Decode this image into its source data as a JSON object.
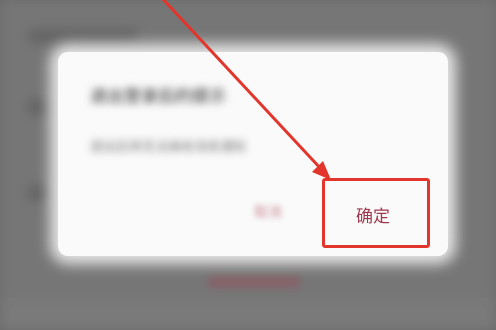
{
  "dialog": {
    "title": "退出登录后的提示",
    "message": "退出后将无法接收消息通知",
    "cancel_label": "取消",
    "confirm_label": "确定"
  },
  "annotation": {
    "color": "#e2362c",
    "accent_color": "#a0374f"
  }
}
